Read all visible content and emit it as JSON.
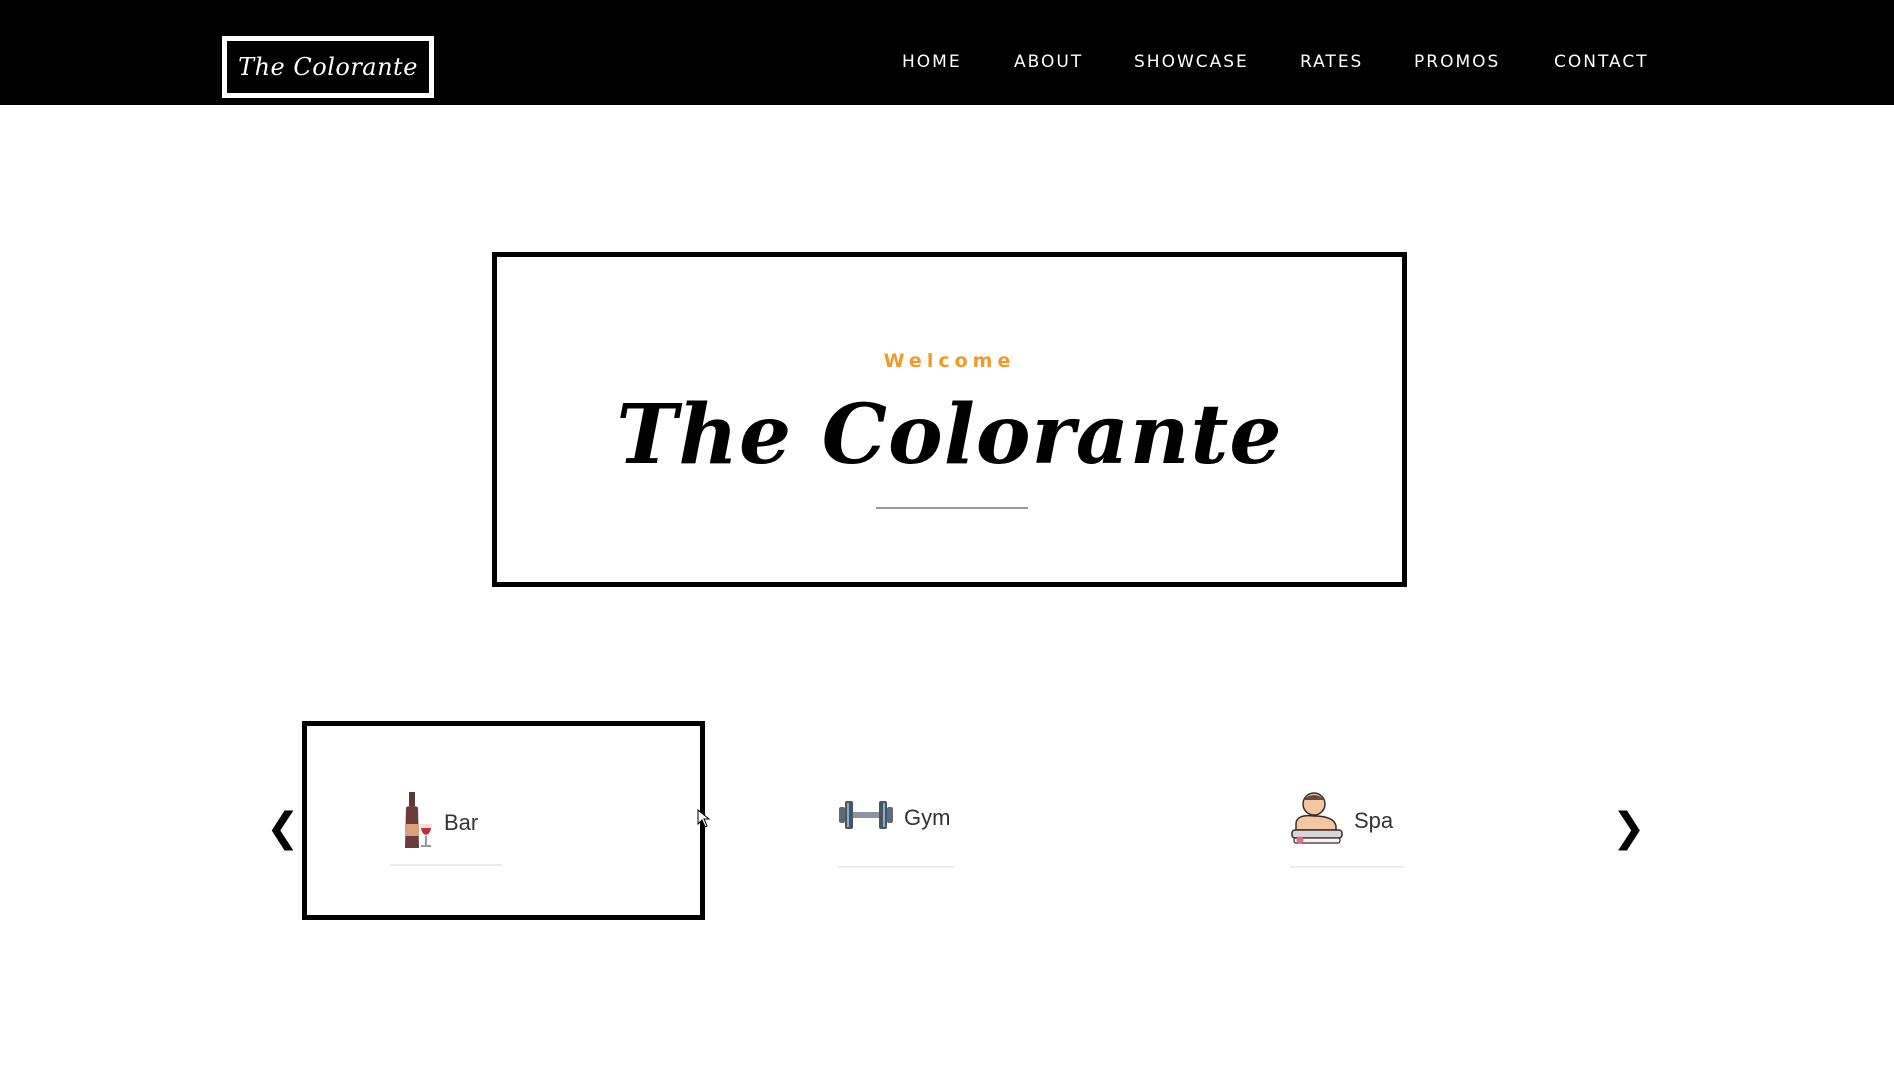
{
  "header": {
    "logo_text": "The Colorante",
    "nav": [
      {
        "label": "HOME"
      },
      {
        "label": "ABOUT"
      },
      {
        "label": "SHOWCASE"
      },
      {
        "label": "RATES"
      },
      {
        "label": "PROMOS"
      },
      {
        "label": "CONTACT"
      }
    ]
  },
  "hero": {
    "eyebrow": "Welcome",
    "title": "The Colorante"
  },
  "carousel": {
    "prev_icon": "chevron-left-icon",
    "next_icon": "chevron-right-icon",
    "prev_glyph": "❮",
    "next_glyph": "❯",
    "items": [
      {
        "label": "Bar",
        "icon": "wine-bottle-icon"
      },
      {
        "label": "Gym",
        "icon": "dumbbell-icon"
      },
      {
        "label": "Spa",
        "icon": "spa-massage-icon"
      }
    ]
  },
  "colors": {
    "header_bg": "#000000",
    "accent": "#ef9a2a",
    "text": "#000000"
  }
}
